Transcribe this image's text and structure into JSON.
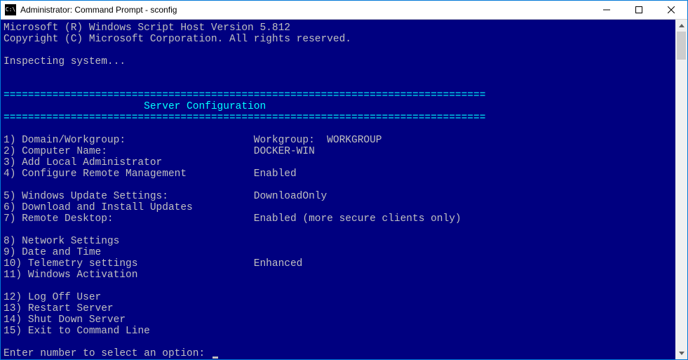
{
  "window": {
    "title": "Administrator: Command Prompt - sconfig"
  },
  "console": {
    "header1": "Microsoft (R) Windows Script Host Version 5.812",
    "header2": "Copyright (C) Microsoft Corporation. All rights reserved.",
    "inspecting": "Inspecting system...",
    "divider": "===============================================================================",
    "title_line": "                       Server Configuration",
    "menu": [
      {
        "num": "1)",
        "label": "Domain/Workgroup:",
        "value": "Workgroup:  WORKGROUP"
      },
      {
        "num": "2)",
        "label": "Computer Name:",
        "value": "DOCKER-WIN"
      },
      {
        "num": "3)",
        "label": "Add Local Administrator",
        "value": ""
      },
      {
        "num": "4)",
        "label": "Configure Remote Management",
        "value": "Enabled"
      }
    ],
    "menu2": [
      {
        "num": "5)",
        "label": "Windows Update Settings:",
        "value": "DownloadOnly"
      },
      {
        "num": "6)",
        "label": "Download and Install Updates",
        "value": ""
      },
      {
        "num": "7)",
        "label": "Remote Desktop:",
        "value": "Enabled (more secure clients only)"
      }
    ],
    "menu3": [
      {
        "num": "8)",
        "label": "Network Settings",
        "value": ""
      },
      {
        "num": "9)",
        "label": "Date and Time",
        "value": ""
      },
      {
        "num": "10)",
        "label": "Telemetry settings",
        "value": "Enhanced"
      },
      {
        "num": "11)",
        "label": "Windows Activation",
        "value": ""
      }
    ],
    "menu4": [
      {
        "num": "12)",
        "label": "Log Off User",
        "value": ""
      },
      {
        "num": "13)",
        "label": "Restart Server",
        "value": ""
      },
      {
        "num": "14)",
        "label": "Shut Down Server",
        "value": ""
      },
      {
        "num": "15)",
        "label": "Exit to Command Line",
        "value": ""
      }
    ],
    "prompt": "Enter number to select an option: "
  }
}
